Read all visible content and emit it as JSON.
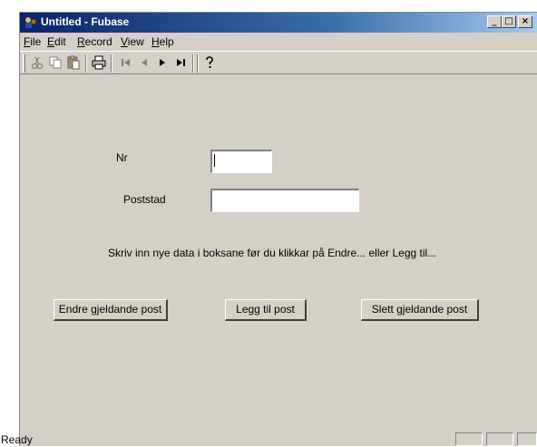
{
  "window": {
    "title": "Untitled - Fubase",
    "controls": {
      "minimize": "_",
      "maximize": "□",
      "close": "×"
    }
  },
  "menu": {
    "items": [
      {
        "label": "File",
        "accel": "F",
        "rest": "ile"
      },
      {
        "label": "Edit",
        "accel": "E",
        "rest": "dit"
      },
      {
        "label": "Record",
        "accel": "R",
        "rest": "ecord"
      },
      {
        "label": "View",
        "accel": "V",
        "rest": "iew"
      },
      {
        "label": "Help",
        "accel": "H",
        "rest": "elp"
      }
    ]
  },
  "toolbar": {
    "tools": [
      "cut-icon",
      "copy-icon",
      "paste-icon",
      "print-icon",
      "first-record-icon",
      "previous-record-icon",
      "next-record-icon",
      "last-record-icon",
      "help-icon"
    ]
  },
  "form": {
    "nr_label": "Nr",
    "nr_value": "",
    "poststad_label": "Poststad",
    "poststad_value": "",
    "instruction": "Skriv inn nye data i boksane før du klikkar på Endre... eller Legg til..."
  },
  "buttons": {
    "edit": "Endre gjeldande post",
    "add": "Legg til post",
    "delete": "Slett gjeldande post"
  },
  "status": {
    "text": "Ready"
  },
  "colors": {
    "title_start": "#0a246a",
    "title_end": "#a6caf0",
    "face": "#d4d0c8"
  }
}
